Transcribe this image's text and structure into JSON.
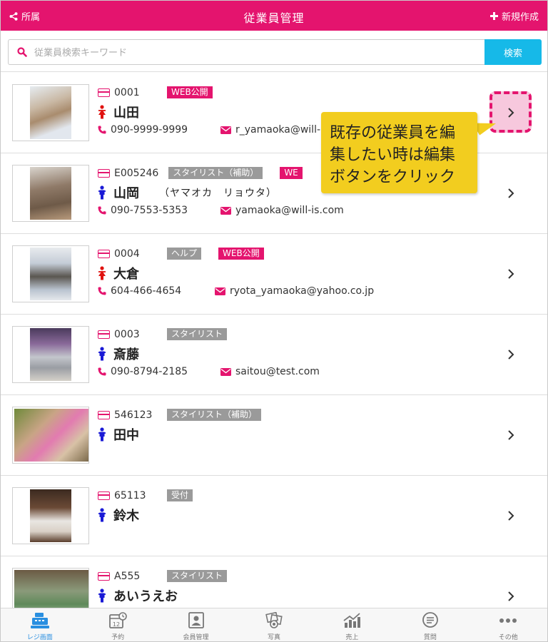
{
  "header": {
    "back_label": "所属",
    "title": "従業員管理",
    "new_label": "新規作成"
  },
  "search": {
    "placeholder": "従業員検索キーワード",
    "button_label": "検索"
  },
  "employees": [
    {
      "code": "0001",
      "badges": [
        {
          "text": "WEB公開",
          "color": "pink"
        }
      ],
      "gender": "female",
      "name": "山田",
      "kana": "",
      "phone": "090-9999-9999",
      "email": "r_yamaoka@will-"
    },
    {
      "code": "E005246",
      "badges": [
        {
          "text": "スタイリスト（補助）",
          "color": "gray"
        },
        {
          "text": "WE",
          "color": "pink"
        }
      ],
      "gender": "male",
      "name": "山岡",
      "kana": "（ヤマオカ　リョウタ）",
      "phone": "090-7553-5353",
      "email": "yamaoka@will-is.com"
    },
    {
      "code": "0004",
      "badges": [
        {
          "text": "ヘルプ",
          "color": "gray"
        },
        {
          "text": "WEB公開",
          "color": "pink"
        }
      ],
      "gender": "female",
      "name": "大倉",
      "kana": "",
      "phone": "604-466-4654",
      "email": "ryota_yamaoka@yahoo.co.jp"
    },
    {
      "code": "0003",
      "badges": [
        {
          "text": "スタイリスト",
          "color": "gray"
        }
      ],
      "gender": "male",
      "name": "斎藤",
      "kana": "",
      "phone": "090-8794-2185",
      "email": "saitou@test.com"
    },
    {
      "code": "546123",
      "badges": [
        {
          "text": "スタイリスト（補助）",
          "color": "gray"
        }
      ],
      "gender": "male",
      "name": "田中",
      "kana": "",
      "phone": "",
      "email": ""
    },
    {
      "code": "65113",
      "badges": [
        {
          "text": "受付",
          "color": "gray"
        }
      ],
      "gender": "male",
      "name": "鈴木",
      "kana": "",
      "phone": "",
      "email": ""
    },
    {
      "code": "A555",
      "badges": [
        {
          "text": "スタイリスト",
          "color": "gray"
        }
      ],
      "gender": "male",
      "name": "あいうえお",
      "kana": "",
      "phone": "",
      "email": ""
    }
  ],
  "tooltip": {
    "lines": [
      "既存の従業員を編",
      "集したい時は編集",
      "ボタンをクリック"
    ]
  },
  "tabs": [
    {
      "label": "レジ画面",
      "icon": "register-icon",
      "active": true
    },
    {
      "label": "予約",
      "icon": "calendar-icon",
      "active": false
    },
    {
      "label": "会員管理",
      "icon": "member-card-icon",
      "active": false
    },
    {
      "label": "写真",
      "icon": "photo-icon",
      "active": false
    },
    {
      "label": "売上",
      "icon": "sales-chart-icon",
      "active": false
    },
    {
      "label": "質問",
      "icon": "chat-bubble-icon",
      "active": false
    },
    {
      "label": "その他",
      "icon": "more-dots-icon",
      "active": false
    }
  ],
  "colors": {
    "brand": "#e4146e",
    "search_button": "#16b9e8",
    "female_icon": "#e0120f",
    "male_icon": "#1a1ad6",
    "tooltip_bg": "#f2cd1f",
    "active_tab": "#2a8fe0"
  }
}
